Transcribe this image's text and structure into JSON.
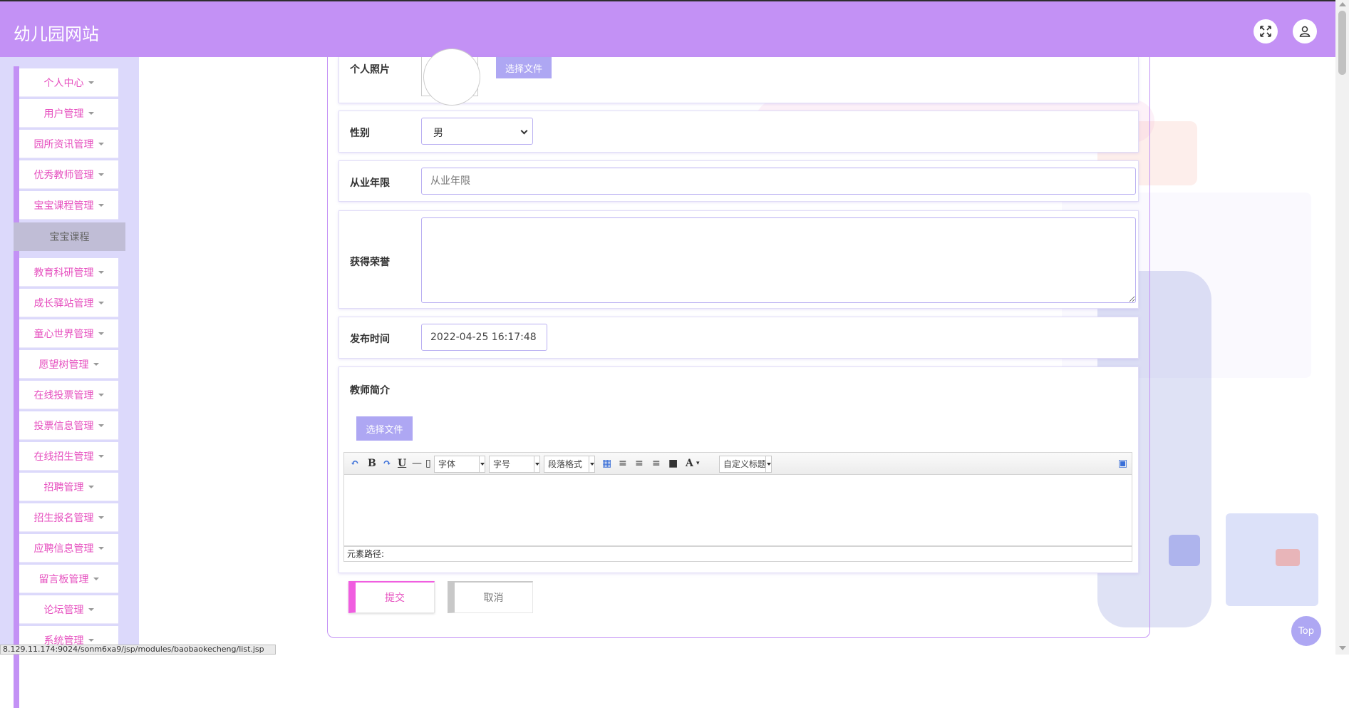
{
  "app": {
    "title": "幼儿园网站"
  },
  "header": {
    "fullscreen_icon": "expand-icon",
    "user_icon": "user-icon"
  },
  "sidebar": {
    "items": [
      {
        "label": "个人中心"
      },
      {
        "label": "用户管理"
      },
      {
        "label": "园所资讯管理"
      },
      {
        "label": "优秀教师管理"
      },
      {
        "label": "宝宝课程管理"
      },
      {
        "label": "教育科研管理"
      },
      {
        "label": "成长驿站管理"
      },
      {
        "label": "童心世界管理"
      },
      {
        "label": "愿望树管理"
      },
      {
        "label": "在线投票管理"
      },
      {
        "label": "投票信息管理"
      },
      {
        "label": "在线招生管理"
      },
      {
        "label": "招聘管理"
      },
      {
        "label": "招生报名管理"
      },
      {
        "label": "应聘信息管理"
      },
      {
        "label": "留言板管理"
      },
      {
        "label": "论坛管理"
      },
      {
        "label": "系统管理"
      }
    ],
    "active_submenu": {
      "label": "宝宝课程"
    }
  },
  "form": {
    "photo": {
      "label": "个人照片",
      "choose_label": "选择文件"
    },
    "gender": {
      "label": "性别",
      "value": "男"
    },
    "years": {
      "label": "从业年限",
      "placeholder": "从业年限"
    },
    "honors": {
      "label": "获得荣誉",
      "value": ""
    },
    "publish_time": {
      "label": "发布时间",
      "value": "2022-04-25 16:17:48"
    },
    "intro": {
      "label": "教师简介",
      "choose_label": "选择文件",
      "editor": {
        "font_label": "字体",
        "size_label": "字号",
        "paragraph_label": "段落格式",
        "custom_title_label": "自定义标题",
        "element_path_label": "元素路径:"
      }
    },
    "submit_label": "提交",
    "cancel_label": "取消"
  },
  "top_button_label": "Top",
  "status_url": "8.129.11.174:9024/sonm6xa9/jsp/modules/baobaokecheng/list.jsp"
}
